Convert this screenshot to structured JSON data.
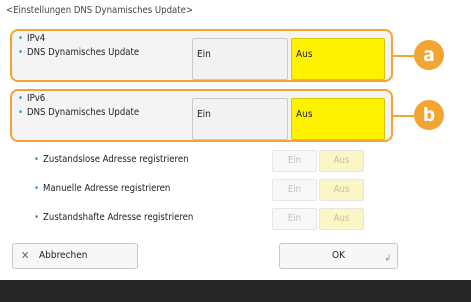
{
  "header": {
    "title": "<Einstellungen DNS Dynamisches Update>"
  },
  "ipv4": {
    "title": "IPv4",
    "row_label": "DNS Dynamisches Update",
    "ein_label": "Ein",
    "aus_label": "Aus",
    "selected": "Aus",
    "callout": "a"
  },
  "ipv6": {
    "title": "IPv6",
    "row_label": "DNS Dynamisches Update",
    "ein_label": "Ein",
    "aus_label": "Aus",
    "selected": "Aus",
    "callout": "b"
  },
  "ipv6_options": [
    {
      "label": "Zustandslose Adresse registrieren",
      "ein_label": "Ein",
      "aus_label": "Aus"
    },
    {
      "label": "Manuelle Adresse registrieren",
      "ein_label": "Ein",
      "aus_label": "Aus"
    },
    {
      "label": "Zustandshafte Adresse registrieren",
      "ein_label": "Ein",
      "aus_label": "Aus"
    }
  ],
  "footer": {
    "cancel_icon": "close-icon",
    "cancel_label": "Abbrechen",
    "ok_label": "OK",
    "ok_icon": "enter-icon"
  },
  "colors": {
    "accent": "#f2a530",
    "selected": "#fff200",
    "bullet": "#2f93c9"
  }
}
